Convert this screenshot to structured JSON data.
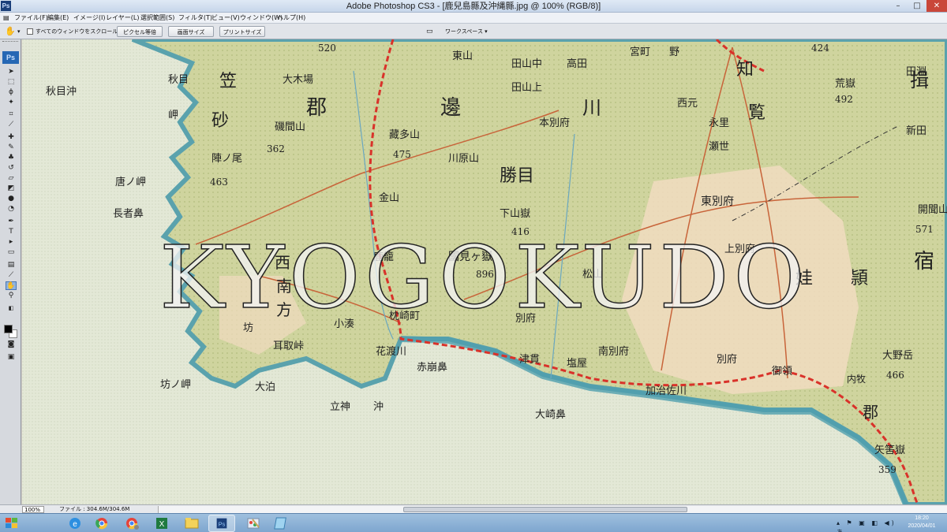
{
  "window": {
    "title": "Adobe Photoshop CS3 - [鹿兒島縣及沖縄縣.jpg @ 100% (RGB/8)]",
    "app_badge": "Ps",
    "min_glyph": "–",
    "max_glyph": "□",
    "close_glyph": "✕"
  },
  "menu": {
    "items": [
      "ファイル(F)",
      "編集(E)",
      "イメージ(I)",
      "レイヤー(L)",
      "選択範囲(S)",
      "フィルタ(T)",
      "ビュー(V)",
      "ウィンドウ(W)",
      "ヘルプ(H)"
    ]
  },
  "options": {
    "scroll_all_label": "すべてのウィンドウをスクロール",
    "actual_pixels_label": "ピクセル等倍",
    "fit_screen_label": "画面サイズ",
    "print_size_label": "プリントサイズ",
    "workspace_label": "ワークスペース ▾"
  },
  "toolbox": {
    "logo": "Ps"
  },
  "document": {
    "watermark": "KYOGOKUDO",
    "map_labels": [
      "秋目沖",
      "笠",
      "砂",
      "郡",
      "大木場",
      "磯間山",
      "362",
      "陣ノ尾",
      "463",
      "唐ノ岬",
      "長者鼻",
      "秋目",
      "岬",
      "坊",
      "西",
      "南",
      "方",
      "小湊",
      "枕崎町",
      "鹿籠",
      "國見ヶ嶽",
      "896",
      "松山",
      "別府",
      "下山嶽",
      "416",
      "勝目",
      "邊",
      "川",
      "藏多山",
      "475",
      "川原山",
      "金山",
      "知",
      "覧",
      "荒嶽",
      "492",
      "永里",
      "瀬世",
      "西元",
      "東別府",
      "上別府",
      "頴",
      "娃",
      "宿",
      "揖",
      "開聞山",
      "571",
      "新田",
      "塩屋",
      "津貫",
      "南別府",
      "別府",
      "御領",
      "内牧",
      "大野岳",
      "466",
      "郡",
      "矢筈嶽",
      "359",
      "立神",
      "沖",
      "大崎鼻",
      "赤崩鼻",
      "花渡川",
      "耳取峠",
      "坊ノ岬",
      "大泊",
      "加治佐川",
      "520",
      "424",
      "宮町",
      "野",
      "田山中",
      "田山上",
      "東山",
      "本別府",
      "高田",
      "田淵"
    ]
  },
  "status": {
    "zoom": "100%",
    "file_info": "ファイル : 304.6M/304.6M"
  },
  "taskbar": {
    "apps": [
      "internet-explorer",
      "chrome",
      "chrome",
      "excel",
      "file-explorer",
      "photoshop",
      "paint",
      "notepad"
    ],
    "tray_glyphs": "▴ ⚑ ▣ ◧ ◀) あ",
    "time": "18:20",
    "date": "2020/04/01"
  }
}
